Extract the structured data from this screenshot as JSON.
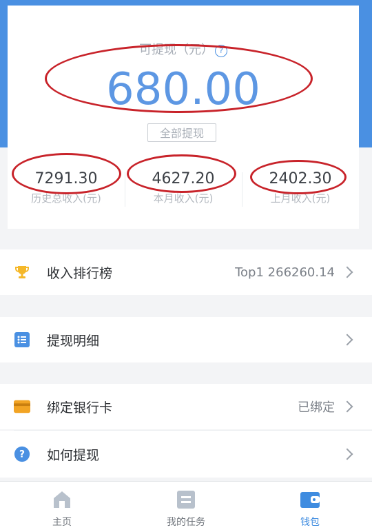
{
  "wallet": {
    "available_label": "可提现（元）",
    "help_symbol": "?",
    "balance": "680.00",
    "withdraw_all_label": "全部提现"
  },
  "stats": [
    {
      "value": "7291.30",
      "label": "历史总收入(元)"
    },
    {
      "value": "4627.20",
      "label": "本月收入(元)"
    },
    {
      "value": "2402.30",
      "label": "上月收入(元)"
    }
  ],
  "menu": {
    "ranking": {
      "label": "收入排行榜",
      "value": "Top1 266260.14",
      "icon": "trophy-icon"
    },
    "withdraw_detail": {
      "label": "提现明细",
      "icon": "list-icon"
    },
    "bind_card": {
      "label": "绑定银行卡",
      "value": "已绑定",
      "icon": "bank-card-icon"
    },
    "how_withdraw": {
      "label": "如何提现",
      "icon": "question-icon",
      "icon_symbol": "?"
    }
  },
  "tabs": [
    {
      "label": "主页",
      "icon": "home-icon",
      "active": false
    },
    {
      "label": "我的任务",
      "icon": "task-icon",
      "active": false
    },
    {
      "label": "钱包",
      "icon": "wallet-icon",
      "active": true
    }
  ],
  "colors": {
    "primary_blue": "#4a90e2",
    "annotation_red": "#c8232a",
    "trophy_gold": "#f5b82a",
    "card_orange": "#f2a424"
  }
}
